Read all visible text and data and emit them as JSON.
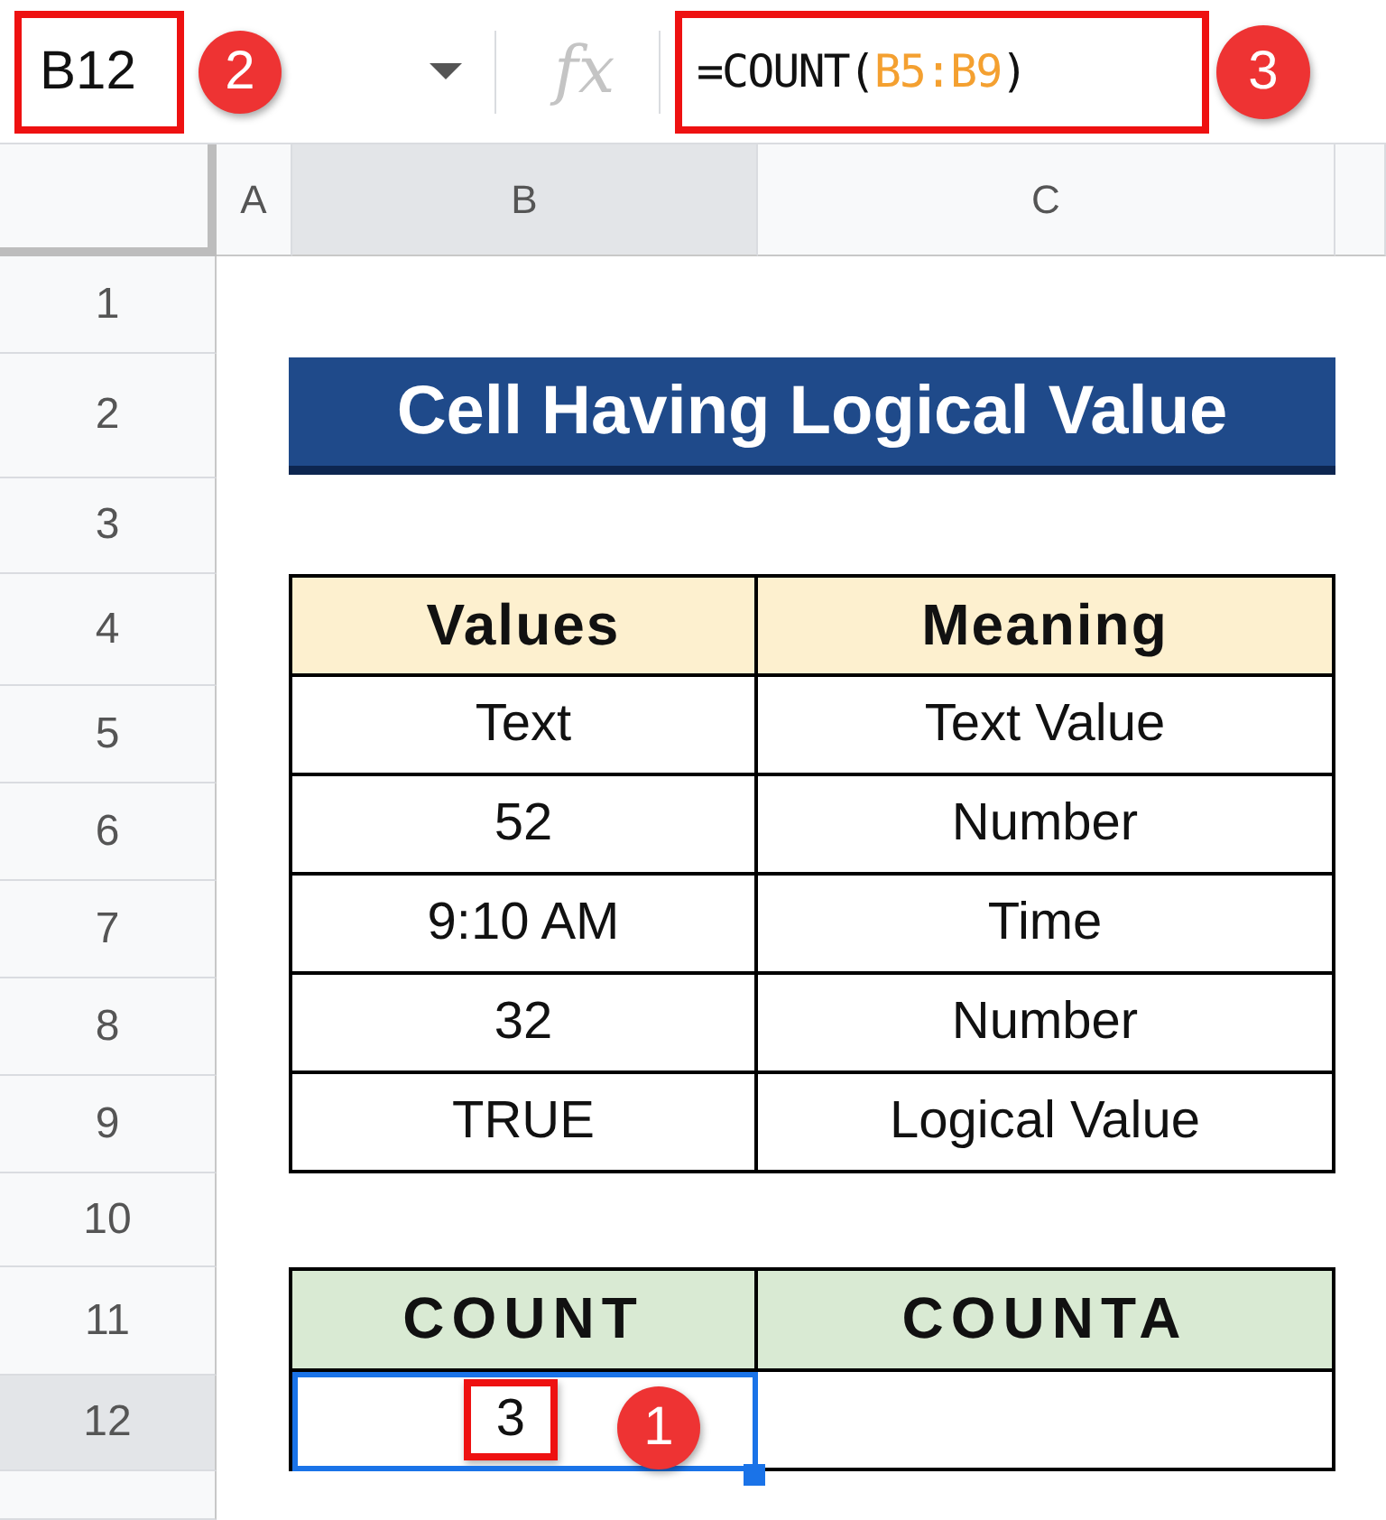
{
  "name_box": {
    "value": "B12",
    "callout": "2"
  },
  "formula_bar": {
    "fx": "fx",
    "formula": [
      {
        "text": "=COUNT(",
        "kind": "plain"
      },
      {
        "text": "B5:B9",
        "kind": "range"
      },
      {
        "text": ")",
        "kind": "plain"
      }
    ],
    "callout": "3"
  },
  "columns": [
    {
      "label": "A",
      "selected": false
    },
    {
      "label": "B",
      "selected": true
    },
    {
      "label": "C",
      "selected": false
    }
  ],
  "rows": [
    {
      "label": "1",
      "selected": false
    },
    {
      "label": "2",
      "selected": false
    },
    {
      "label": "3",
      "selected": false
    },
    {
      "label": "4",
      "selected": false
    },
    {
      "label": "5",
      "selected": false
    },
    {
      "label": "6",
      "selected": false
    },
    {
      "label": "7",
      "selected": false
    },
    {
      "label": "8",
      "selected": false
    },
    {
      "label": "9",
      "selected": false
    },
    {
      "label": "10",
      "selected": false
    },
    {
      "label": "11",
      "selected": false
    },
    {
      "label": "12",
      "selected": true
    }
  ],
  "title": "Cell Having Logical Value",
  "values_table": {
    "headers": [
      "Values",
      "Meaning"
    ],
    "rows": [
      [
        "Text",
        "Text Value"
      ],
      [
        "52",
        "Number"
      ],
      [
        "9:10 AM",
        "Time"
      ],
      [
        "32",
        "Number"
      ],
      [
        "TRUE",
        "Logical Value"
      ]
    ]
  },
  "count_table": {
    "headers": [
      "COUNT",
      "COUNTA"
    ],
    "result": {
      "value": "3",
      "selected": true,
      "callout": "1"
    }
  }
}
